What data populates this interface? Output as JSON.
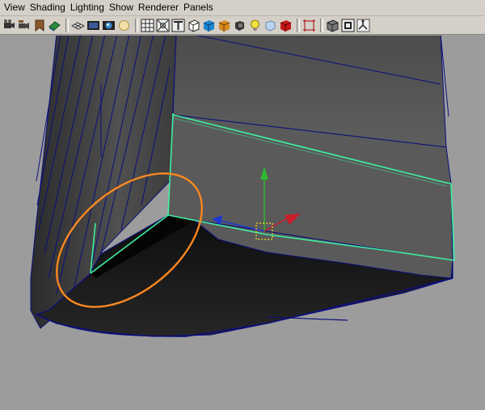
{
  "menu": {
    "items": [
      "View",
      "Shading",
      "Lighting",
      "Show",
      "Renderer",
      "Panels"
    ]
  },
  "toolbar": {
    "groups": [
      [
        "select-camera-icon",
        "camera-attributes-icon",
        "bookmark-icon",
        "image-plane-icon"
      ],
      [
        "grid-icon",
        "film-gate-icon",
        "resolution-gate-icon",
        "safe-action-icon"
      ],
      [
        "wireframe-icon",
        "xray-icon",
        "texture-icon",
        "smooth-shade-icon",
        "wireframe-on-shaded-icon",
        "bounding-box-icon",
        "flat-shade-icon",
        "use-all-lights-icon",
        "default-light-icon",
        "high-quality-icon"
      ],
      [
        "isolate-select-icon"
      ],
      [
        "xray-joints-icon",
        "shadow-icon",
        "camera-tools-icon"
      ]
    ]
  },
  "colors": {
    "ui_bg": "#d4d0c8",
    "viewport_bg": "#9c9c9c",
    "mesh_face": "#5e5e5e",
    "mesh_dark": "#1a1a1a",
    "wire_edge": "#0b0f7a",
    "selected_edge": "#3ef0a0",
    "rotate_ring": "#f07a10",
    "manip_y": "#2fb82f",
    "manip_x": "#c81e2a",
    "pivot": "#f0e020"
  }
}
